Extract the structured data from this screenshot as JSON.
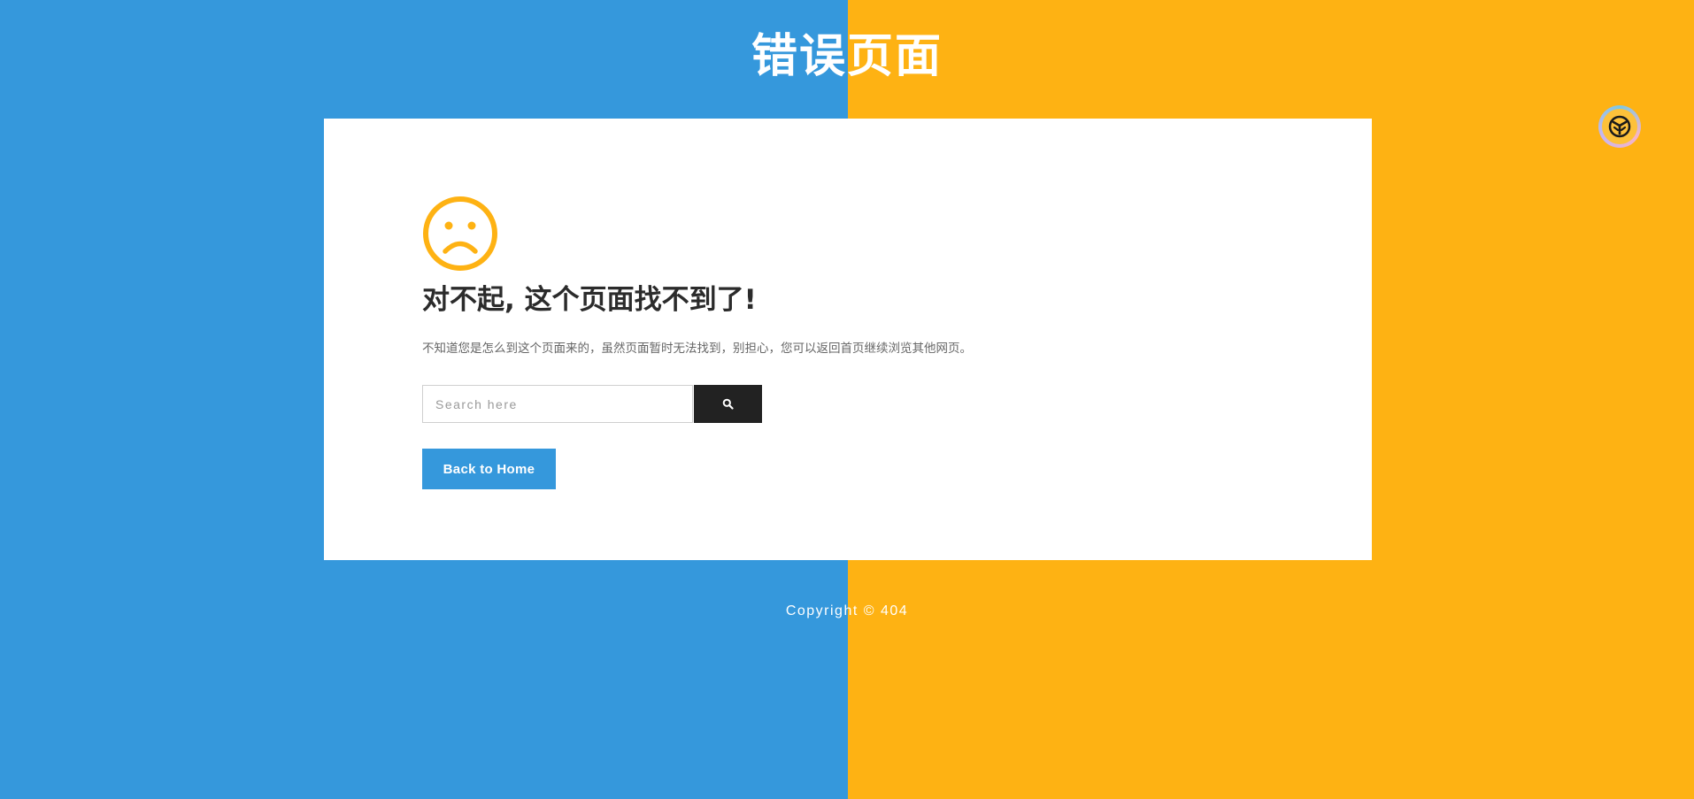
{
  "header": {
    "title": "错误页面"
  },
  "card": {
    "icon": "sad-face-icon",
    "heading": "对不起, 这个页面找不到了!",
    "description": "不知道您是怎么到这个页面来的，虽然页面暂时无法找到，别担心，您可以返回首页继续浏览其他网页。",
    "search": {
      "placeholder": "Search here",
      "value": "",
      "button_icon": "search-icon"
    },
    "home_button_label": "Back to Home"
  },
  "footer": {
    "copyright": "Copyright © 404"
  },
  "floating_widget": {
    "icon": "assistant-logo-icon"
  },
  "colors": {
    "left_background": "#3598DC",
    "right_background": "#FEB213",
    "card_background": "#FFFFFF",
    "accent_yellow": "#FEB213",
    "accent_blue": "#3598DC",
    "dark_button": "#222222",
    "heading_text": "#2B2B2B",
    "body_text": "#666666"
  }
}
